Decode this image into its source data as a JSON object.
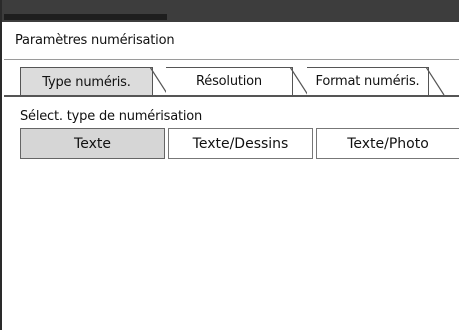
{
  "panel": {
    "title": "Paramètres numérisation"
  },
  "tabs": [
    {
      "label": "Type numéris.",
      "active": true
    },
    {
      "label": "Résolution",
      "active": false
    },
    {
      "label": "Format numéris.",
      "active": false
    }
  ],
  "scan_type": {
    "label": "Sélect. type de numérisation",
    "options": [
      {
        "label": "Texte",
        "selected": true
      },
      {
        "label": "Texte/Dessins",
        "selected": false
      },
      {
        "label": "Texte/Photo",
        "selected": false
      }
    ]
  },
  "colors": {
    "top_bar": "#3d3d3d",
    "selected_fill": "#d6d6d6",
    "active_tab_fill": "#dcdcdc"
  }
}
